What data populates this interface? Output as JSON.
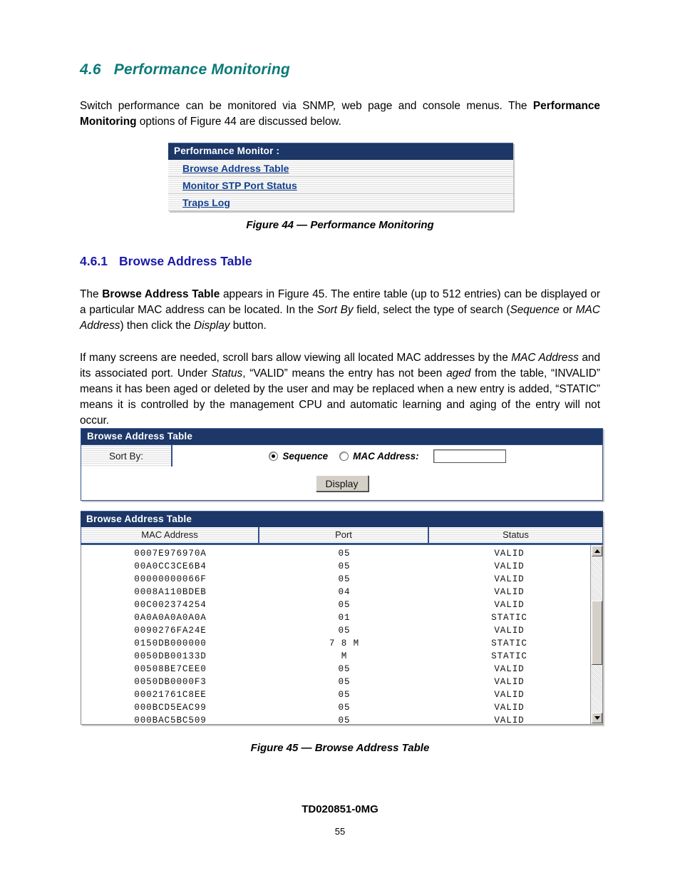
{
  "section": {
    "number": "4.6",
    "title": "Performance Monitoring",
    "color": "#0b7a78"
  },
  "intro_paragraph": {
    "part1": "Switch performance can be monitored via SNMP, web page and console menus.  The ",
    "bold1": "Performance Monitoring",
    "part2": " options of Figure 44 are discussed below."
  },
  "figure44": {
    "caption": "Figure 44 — Performance Monitoring",
    "panel_title": "Performance Monitor :",
    "links": [
      {
        "label": "Browse Address Table"
      },
      {
        "label": "Monitor STP Port Status"
      },
      {
        "label": "Traps Log"
      }
    ],
    "header_color": "#1c3768",
    "link_color": "#14418f"
  },
  "subsection": {
    "number": "4.6.1",
    "title": "Browse Address Table",
    "color": "#1a1aa8"
  },
  "paragraph2": {
    "part1": "The ",
    "bold1": "Browse Address Table",
    "part2": " appears in Figure 45.  The entire table (up to 512 entries) can be displayed or a particular MAC address can be located.  In the ",
    "italic1": "Sort By",
    "part3": " field, select the type of search (",
    "italic2": "Sequence",
    "part4": " or ",
    "italic3": "MAC Address",
    "part5": ") then click the ",
    "italic4": "Display",
    "part6": " button."
  },
  "paragraph3": {
    "part1": "If many screens are needed, scroll bars allow viewing all located MAC addresses by the ",
    "italic1": "MAC Address",
    "part2": " and its associated port.  Under ",
    "italic2": "Status",
    "part3": ", “VALID” means the entry has not been ",
    "italic3": "aged",
    "part4": " from the table, “INVALID” means it has been aged or deleted by the user and may be replaced when a new entry is added, “STATIC” means it is controlled by the management CPU and automatic learning and aging of the entry will not occur."
  },
  "figure45": {
    "caption": "Figure 45 — Browse Address Table",
    "form": {
      "panel_title": "Browse Address Table",
      "sort_by_label": "Sort By:",
      "options": [
        {
          "label": "Sequence",
          "selected": true
        },
        {
          "label": "MAC Address:",
          "selected": false
        }
      ],
      "mac_input_value": "",
      "mac_input_placeholder": "",
      "display_button": "Display"
    },
    "results": {
      "panel_title": "Browse Address Table",
      "columns": [
        "MAC Address",
        "Port",
        "Status"
      ],
      "rows": [
        {
          "mac": "0007E976970A",
          "port": "05",
          "status": "VALID"
        },
        {
          "mac": "00A0CC3CE6B4",
          "port": "05",
          "status": "VALID"
        },
        {
          "mac": "00000000066F",
          "port": "05",
          "status": "VALID"
        },
        {
          "mac": "0008A110BDEB",
          "port": "04",
          "status": "VALID"
        },
        {
          "mac": "00C002374254",
          "port": "05",
          "status": "VALID"
        },
        {
          "mac": "0A0A0A0A0A0A",
          "port": "01",
          "status": "STATIC"
        },
        {
          "mac": "0090276FA24E",
          "port": "05",
          "status": "VALID"
        },
        {
          "mac": "0150DB000000",
          "port": "7 8 M",
          "status": "STATIC"
        },
        {
          "mac": "0050DB00133D",
          "port": "M",
          "status": "STATIC"
        },
        {
          "mac": "00508BE7CEE0",
          "port": "05",
          "status": "VALID"
        },
        {
          "mac": "0050DB0000F3",
          "port": "05",
          "status": "VALID"
        },
        {
          "mac": "00021761C8EE",
          "port": "05",
          "status": "VALID"
        },
        {
          "mac": "000BCD5EAC99",
          "port": "05",
          "status": "VALID"
        },
        {
          "mac": "000BAC5BC509",
          "port": "05",
          "status": "VALID"
        }
      ],
      "scrollbar": {
        "up_arrow": "scroll-up-arrow",
        "down_arrow": "scroll-down-arrow"
      }
    }
  },
  "footer": {
    "code": "TD020851-0MG",
    "page_number": "55"
  }
}
